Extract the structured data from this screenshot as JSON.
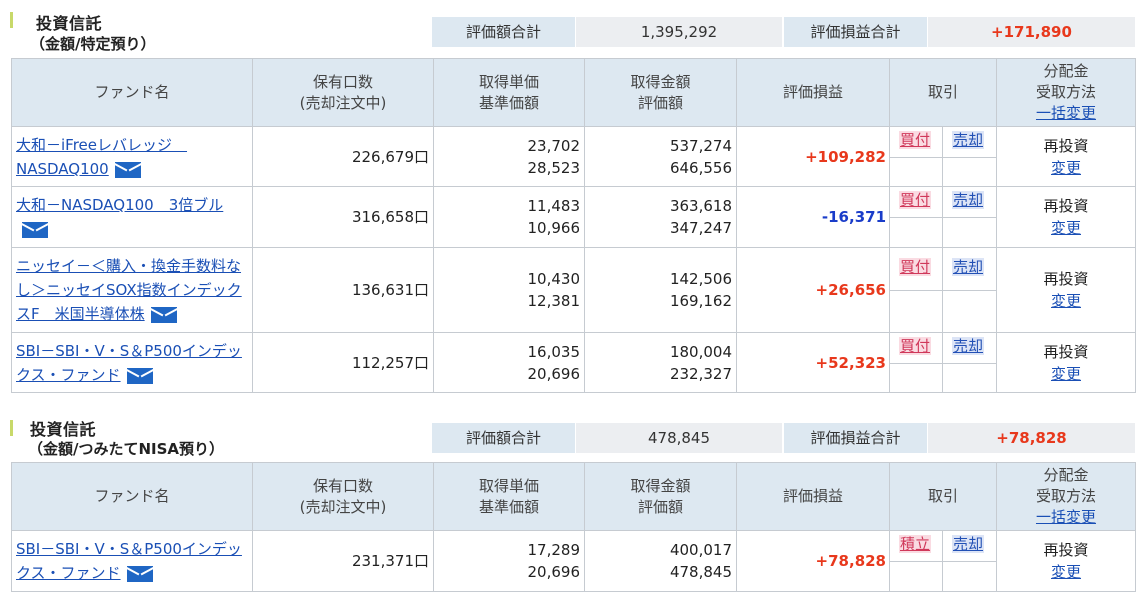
{
  "sections": [
    {
      "title1": "投資信託",
      "title2": "（金額/特定預り）",
      "summary": {
        "valuation_label": "評価額合計",
        "valuation_value": "1,395,292",
        "gain_label": "評価損益合計",
        "gain_value": "+171,890"
      },
      "headers": {
        "fund": "ファンド名",
        "holding_1": "保有口数",
        "holding_2": "(売却注文中)",
        "unit_1": "取得単価",
        "unit_2": "基準価額",
        "amount_1": "取得金額",
        "amount_2": "評価額",
        "gain": "評価損益",
        "trade": "取引",
        "dist_1": "分配金",
        "dist_2": "受取方法",
        "dist_link": "一括変更"
      },
      "rows": [
        {
          "fund": "大和－iFreeレバレッジ　NASDAQ100",
          "holding": "226,679口",
          "unit_cost": "23,702",
          "nav": "28,523",
          "cost": "537,274",
          "value": "646,556",
          "gain": "+109,282",
          "buy": "買付",
          "sell": "売却",
          "dist": "再投資",
          "dist_link": "変更"
        },
        {
          "fund": "大和－NASDAQ100　3倍ブル",
          "holding": "316,658口",
          "unit_cost": "11,483",
          "nav": "10,966",
          "cost": "363,618",
          "value": "347,247",
          "gain": "-16,371",
          "buy": "買付",
          "sell": "売却",
          "dist": "再投資",
          "dist_link": "変更"
        },
        {
          "fund": "ニッセイ－＜購入・換金手数料なし＞ニッセイSOX指数インデックスF　米国半導体株",
          "holding": "136,631口",
          "unit_cost": "10,430",
          "nav": "12,381",
          "cost": "142,506",
          "value": "169,162",
          "gain": "+26,656",
          "buy": "買付",
          "sell": "売却",
          "dist": "再投資",
          "dist_link": "変更"
        },
        {
          "fund": "SBI－SBI・V・S＆P500インデックス・ファンド",
          "holding": "112,257口",
          "unit_cost": "16,035",
          "nav": "20,696",
          "cost": "180,004",
          "value": "232,327",
          "gain": "+52,323",
          "buy": "買付",
          "sell": "売却",
          "dist": "再投資",
          "dist_link": "変更"
        }
      ]
    },
    {
      "title1": "投資信託",
      "title2": "（金額/つみたてNISA預り）",
      "summary": {
        "valuation_label": "評価額合計",
        "valuation_value": "478,845",
        "gain_label": "評価損益合計",
        "gain_value": "+78,828"
      },
      "headers": {
        "fund": "ファンド名",
        "holding_1": "保有口数",
        "holding_2": "(売却注文中)",
        "unit_1": "取得単価",
        "unit_2": "基準価額",
        "amount_1": "取得金額",
        "amount_2": "評価額",
        "gain": "評価損益",
        "trade": "取引",
        "dist_1": "分配金",
        "dist_2": "受取方法",
        "dist_link": "一括変更"
      },
      "rows": [
        {
          "fund": "SBI－SBI・V・S＆P500インデックス・ファンド",
          "holding": "231,371口",
          "unit_cost": "17,289",
          "nav": "20,696",
          "cost": "400,017",
          "value": "478,845",
          "gain": "+78,828",
          "buy": "積立",
          "sell": "売却",
          "dist": "再投資",
          "dist_link": "変更"
        }
      ]
    }
  ],
  "colors": {
    "positive": "#e8381c",
    "negative": "#1a3cc9",
    "header_bg": "#dde8f1",
    "link": "#1a4fb5"
  },
  "icons": {
    "mail": "mail-icon"
  }
}
